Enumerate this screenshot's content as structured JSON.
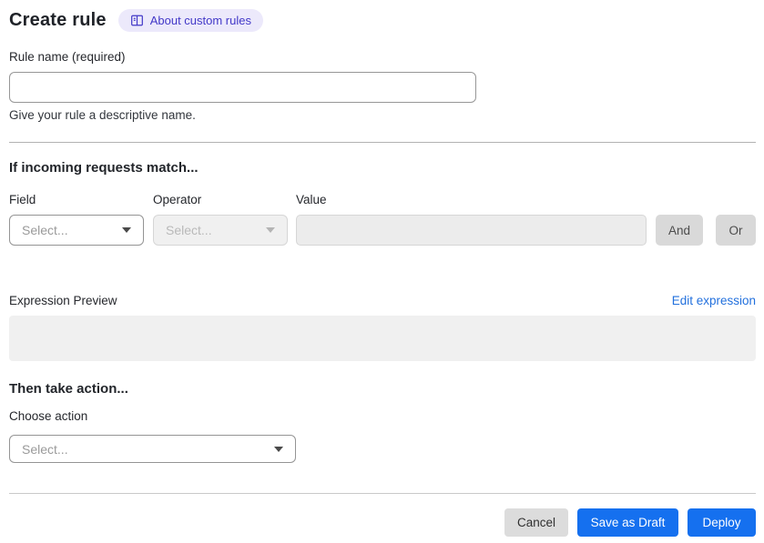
{
  "header": {
    "title": "Create rule",
    "about_link": "About custom rules"
  },
  "rule_name": {
    "label": "Rule name (required)",
    "value": "",
    "helper": "Give your rule a descriptive name."
  },
  "match_section": {
    "heading": "If incoming requests match...",
    "field": {
      "label": "Field",
      "selected": "Select..."
    },
    "operator": {
      "label": "Operator",
      "selected": "Select..."
    },
    "value": {
      "label": "Value",
      "value": ""
    },
    "and_button": "And",
    "or_button": "Or",
    "expression_preview_label": "Expression Preview",
    "edit_expression_link": "Edit expression",
    "expression_value": ""
  },
  "action_section": {
    "heading": "Then take action...",
    "choose_action_label": "Choose action",
    "action_selected": "Select..."
  },
  "footer": {
    "cancel": "Cancel",
    "save_as_draft": "Save as Draft",
    "deploy": "Deploy"
  },
  "colors": {
    "primary_blue": "#1570ef",
    "link_blue": "#2270dd",
    "badge_bg": "#ece9fb",
    "badge_text": "#4238c8",
    "disabled_fill": "#ececec",
    "gray_button": "#d9d9d9"
  }
}
